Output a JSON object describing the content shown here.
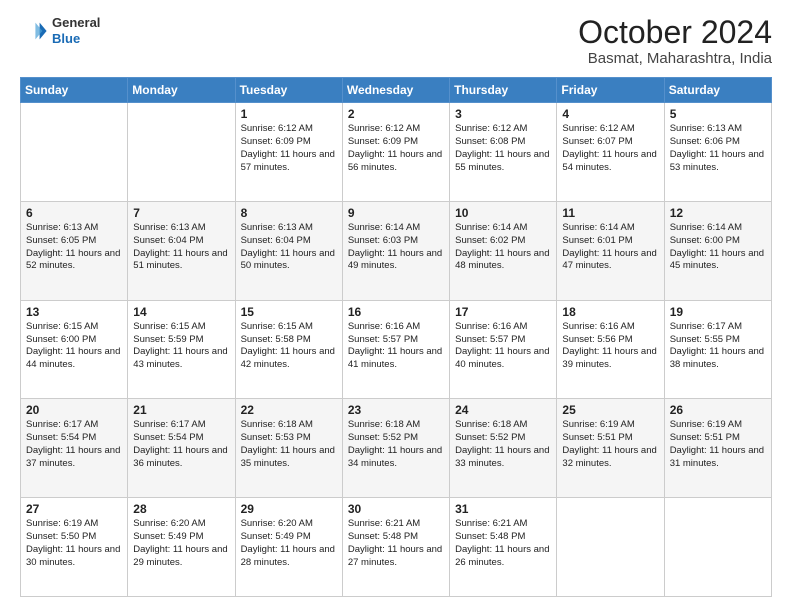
{
  "header": {
    "logo": {
      "general": "General",
      "blue": "Blue"
    },
    "title": "October 2024",
    "location": "Basmat, Maharashtra, India"
  },
  "days_of_week": [
    "Sunday",
    "Monday",
    "Tuesday",
    "Wednesday",
    "Thursday",
    "Friday",
    "Saturday"
  ],
  "weeks": [
    [
      null,
      null,
      {
        "day": 1,
        "sunrise": "6:12 AM",
        "sunset": "6:09 PM",
        "daylight": "11 hours and 57 minutes."
      },
      {
        "day": 2,
        "sunrise": "6:12 AM",
        "sunset": "6:09 PM",
        "daylight": "11 hours and 56 minutes."
      },
      {
        "day": 3,
        "sunrise": "6:12 AM",
        "sunset": "6:08 PM",
        "daylight": "11 hours and 55 minutes."
      },
      {
        "day": 4,
        "sunrise": "6:12 AM",
        "sunset": "6:07 PM",
        "daylight": "11 hours and 54 minutes."
      },
      {
        "day": 5,
        "sunrise": "6:13 AM",
        "sunset": "6:06 PM",
        "daylight": "11 hours and 53 minutes."
      }
    ],
    [
      {
        "day": 6,
        "sunrise": "6:13 AM",
        "sunset": "6:05 PM",
        "daylight": "11 hours and 52 minutes."
      },
      {
        "day": 7,
        "sunrise": "6:13 AM",
        "sunset": "6:04 PM",
        "daylight": "11 hours and 51 minutes."
      },
      {
        "day": 8,
        "sunrise": "6:13 AM",
        "sunset": "6:04 PM",
        "daylight": "11 hours and 50 minutes."
      },
      {
        "day": 9,
        "sunrise": "6:14 AM",
        "sunset": "6:03 PM",
        "daylight": "11 hours and 49 minutes."
      },
      {
        "day": 10,
        "sunrise": "6:14 AM",
        "sunset": "6:02 PM",
        "daylight": "11 hours and 48 minutes."
      },
      {
        "day": 11,
        "sunrise": "6:14 AM",
        "sunset": "6:01 PM",
        "daylight": "11 hours and 47 minutes."
      },
      {
        "day": 12,
        "sunrise": "6:14 AM",
        "sunset": "6:00 PM",
        "daylight": "11 hours and 45 minutes."
      }
    ],
    [
      {
        "day": 13,
        "sunrise": "6:15 AM",
        "sunset": "6:00 PM",
        "daylight": "11 hours and 44 minutes."
      },
      {
        "day": 14,
        "sunrise": "6:15 AM",
        "sunset": "5:59 PM",
        "daylight": "11 hours and 43 minutes."
      },
      {
        "day": 15,
        "sunrise": "6:15 AM",
        "sunset": "5:58 PM",
        "daylight": "11 hours and 42 minutes."
      },
      {
        "day": 16,
        "sunrise": "6:16 AM",
        "sunset": "5:57 PM",
        "daylight": "11 hours and 41 minutes."
      },
      {
        "day": 17,
        "sunrise": "6:16 AM",
        "sunset": "5:57 PM",
        "daylight": "11 hours and 40 minutes."
      },
      {
        "day": 18,
        "sunrise": "6:16 AM",
        "sunset": "5:56 PM",
        "daylight": "11 hours and 39 minutes."
      },
      {
        "day": 19,
        "sunrise": "6:17 AM",
        "sunset": "5:55 PM",
        "daylight": "11 hours and 38 minutes."
      }
    ],
    [
      {
        "day": 20,
        "sunrise": "6:17 AM",
        "sunset": "5:54 PM",
        "daylight": "11 hours and 37 minutes."
      },
      {
        "day": 21,
        "sunrise": "6:17 AM",
        "sunset": "5:54 PM",
        "daylight": "11 hours and 36 minutes."
      },
      {
        "day": 22,
        "sunrise": "6:18 AM",
        "sunset": "5:53 PM",
        "daylight": "11 hours and 35 minutes."
      },
      {
        "day": 23,
        "sunrise": "6:18 AM",
        "sunset": "5:52 PM",
        "daylight": "11 hours and 34 minutes."
      },
      {
        "day": 24,
        "sunrise": "6:18 AM",
        "sunset": "5:52 PM",
        "daylight": "11 hours and 33 minutes."
      },
      {
        "day": 25,
        "sunrise": "6:19 AM",
        "sunset": "5:51 PM",
        "daylight": "11 hours and 32 minutes."
      },
      {
        "day": 26,
        "sunrise": "6:19 AM",
        "sunset": "5:51 PM",
        "daylight": "11 hours and 31 minutes."
      }
    ],
    [
      {
        "day": 27,
        "sunrise": "6:19 AM",
        "sunset": "5:50 PM",
        "daylight": "11 hours and 30 minutes."
      },
      {
        "day": 28,
        "sunrise": "6:20 AM",
        "sunset": "5:49 PM",
        "daylight": "11 hours and 29 minutes."
      },
      {
        "day": 29,
        "sunrise": "6:20 AM",
        "sunset": "5:49 PM",
        "daylight": "11 hours and 28 minutes."
      },
      {
        "day": 30,
        "sunrise": "6:21 AM",
        "sunset": "5:48 PM",
        "daylight": "11 hours and 27 minutes."
      },
      {
        "day": 31,
        "sunrise": "6:21 AM",
        "sunset": "5:48 PM",
        "daylight": "11 hours and 26 minutes."
      },
      null,
      null
    ]
  ]
}
